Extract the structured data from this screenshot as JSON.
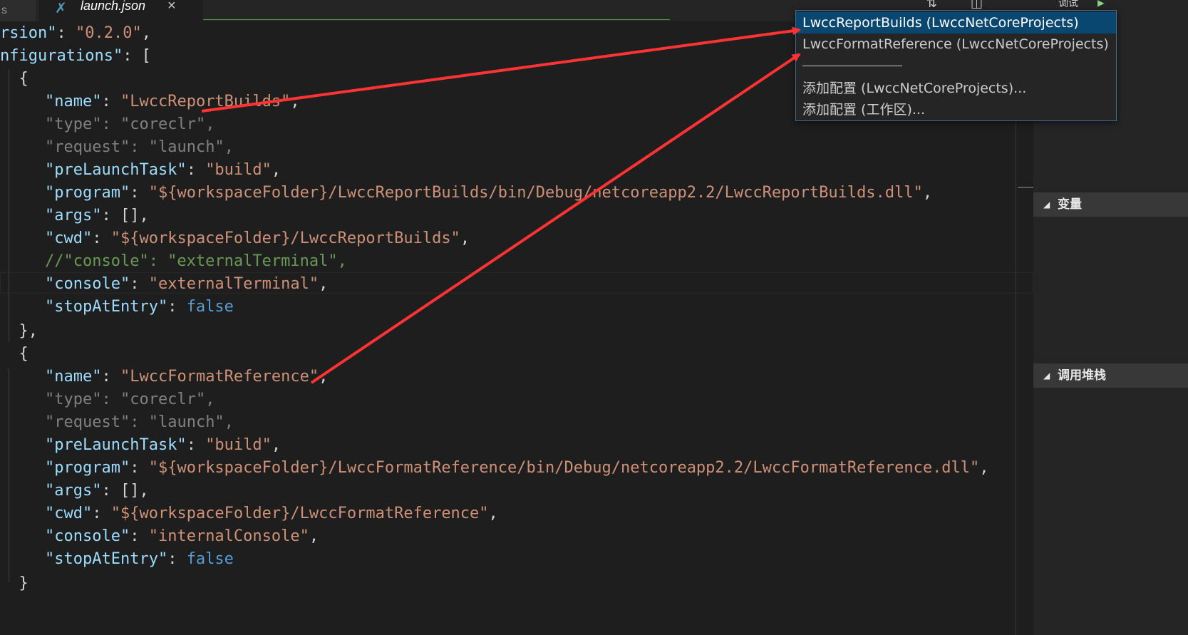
{
  "tabs": {
    "partial_label": "s",
    "active_label": "launch.json",
    "active_icon": "vscode-json-icon",
    "close_glyph": "×"
  },
  "toolbar": {
    "debug_label": "调试"
  },
  "dropdown": {
    "items": [
      {
        "label": "LwccReportBuilds (LwccNetCoreProjects)",
        "selected": true
      },
      {
        "label": "LwccFormatReference (LwccNetCoreProjects)",
        "selected": false
      },
      {
        "label": "添加配置 (LwccNetCoreProjects)...",
        "selected": false
      },
      {
        "label": "添加配置 (工作区)...",
        "selected": false
      }
    ]
  },
  "sidepanel": {
    "variables_label": "变量",
    "callstack_label": "调用堆栈"
  },
  "code": {
    "version_key": "rsion\"",
    "version_val": "\"0.2.0\"",
    "configurations_key": "nfigurations\"",
    "config1": {
      "name_key": "\"name\"",
      "name_val": "\"LwccReportBuilds\"",
      "type_key": "\"type\"",
      "type_val": "\"coreclr\"",
      "request_key": "\"request\"",
      "request_val": "\"launch\"",
      "prelaunch_key": "\"preLaunchTask\"",
      "prelaunch_val": "\"build\"",
      "program_key": "\"program\"",
      "program_val": "\"${workspaceFolder}/LwccReportBuilds/bin/Debug/netcoreapp2.2/LwccReportBuilds.dll\"",
      "args_key": "\"args\"",
      "args_val": "[]",
      "cwd_key": "\"cwd\"",
      "cwd_val": "\"${workspaceFolder}/LwccReportBuilds\"",
      "comment": "//\"console\": \"externalTerminal\",",
      "console_key": "\"console\"",
      "console_val": "\"externalTerminal\"",
      "stop_key": "\"stopAtEntry\"",
      "stop_val": "false"
    },
    "config2": {
      "name_key": "\"name\"",
      "name_val": "\"LwccFormatReference\"",
      "type_key": "\"type\"",
      "type_val": "\"coreclr\"",
      "request_key": "\"request\"",
      "request_val": "\"launch\"",
      "prelaunch_key": "\"preLaunchTask\"",
      "prelaunch_val": "\"build\"",
      "program_key": "\"program\"",
      "program_val": "\"${workspaceFolder}/LwccFormatReference/bin/Debug/netcoreapp2.2/LwccFormatReference.dll\"",
      "args_key": "\"args\"",
      "args_val": "[]",
      "cwd_key": "\"cwd\"",
      "cwd_val": "\"${workspaceFolder}/LwccFormatReference\"",
      "console_key": "\"console\"",
      "console_val": "\"internalConsole\"",
      "stop_key": "\"stopAtEntry\"",
      "stop_val": "false"
    }
  },
  "colors": {
    "annotation_arrow": "#ff3333",
    "selection": "#094771",
    "editor_bg": "#1e1e1e"
  }
}
